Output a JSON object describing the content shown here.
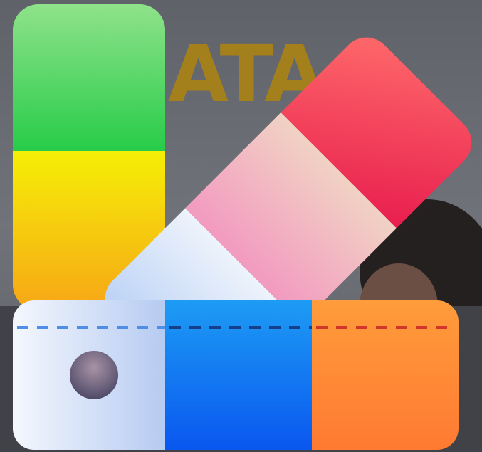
{
  "background": {
    "wall_color": "#6c6f77",
    "wall_light": "#8a8d94",
    "sign_letters": "ATA",
    "sign_color": "#b18a1e"
  },
  "icon": {
    "name": "color-palette-swatch-icon",
    "strip_left": [
      "#4bd86c",
      "#f7c20c"
    ],
    "strip_diagonal": [
      "#f24b5f",
      "#f3b0bd",
      "#cfe0f7"
    ],
    "strip_bottom": [
      "#e3ecfb",
      "#1679f3",
      "#fe8c35"
    ],
    "dash_colors": [
      "#4f8ee6",
      "#153e8c",
      "#d2352a"
    ],
    "dot_color": "#7c6a86"
  }
}
